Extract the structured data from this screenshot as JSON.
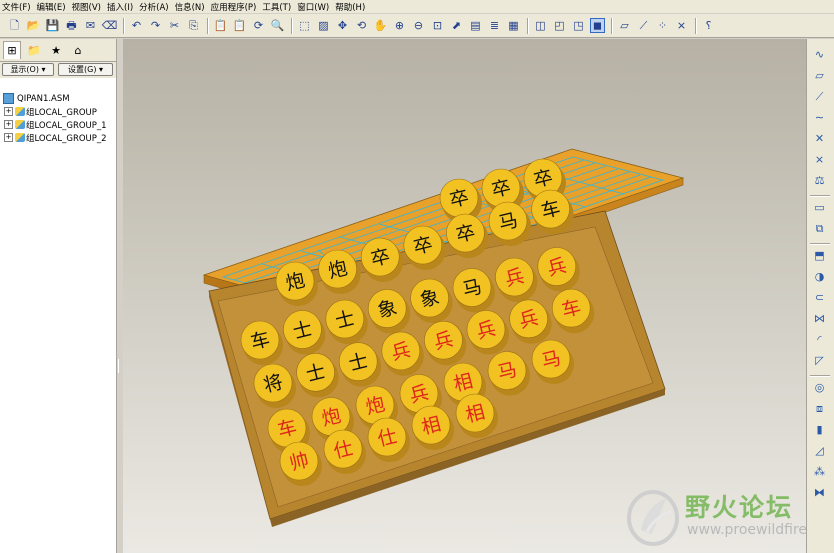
{
  "menu": [
    "文件(F)",
    "编辑(E)",
    "视图(V)",
    "插入(I)",
    "分析(A)",
    "信息(N)",
    "应用程序(P)",
    "工具(T)",
    "窗口(W)",
    "帮助(H)"
  ],
  "toolbar_icons": [
    {
      "name": "new-icon",
      "glyph": "🗋"
    },
    {
      "name": "open-icon",
      "glyph": "📂"
    },
    {
      "name": "save-icon",
      "glyph": "💾"
    },
    {
      "name": "print-icon",
      "glyph": "🖶"
    },
    {
      "name": "send-icon",
      "glyph": "✉"
    },
    {
      "name": "erase-icon",
      "glyph": "⌫"
    },
    {
      "name": "undo-icon",
      "glyph": "↶"
    },
    {
      "name": "redo-icon",
      "glyph": "↷"
    },
    {
      "name": "cut-icon",
      "glyph": "✂"
    },
    {
      "name": "copy-icon",
      "glyph": "⎘"
    },
    {
      "name": "paste-icon",
      "glyph": "📋"
    },
    {
      "name": "paste-special-icon",
      "glyph": "📋"
    },
    {
      "name": "regenerate-icon",
      "glyph": "⟳"
    },
    {
      "name": "find-icon",
      "glyph": "🔍"
    },
    {
      "name": "select-box-icon",
      "glyph": "⬚"
    },
    {
      "name": "repaint-icon",
      "glyph": "▨"
    },
    {
      "name": "spin-center-icon",
      "glyph": "✥"
    },
    {
      "name": "orient-icon",
      "glyph": "⟲"
    },
    {
      "name": "pan-icon",
      "glyph": "✋"
    },
    {
      "name": "zoom-in-icon",
      "glyph": "⊕"
    },
    {
      "name": "zoom-out-icon",
      "glyph": "⊖"
    },
    {
      "name": "refit-icon",
      "glyph": "⊡"
    },
    {
      "name": "view-orient-icon",
      "glyph": "⬈"
    },
    {
      "name": "saved-views-icon",
      "glyph": "▤"
    },
    {
      "name": "layers-icon",
      "glyph": "≣"
    },
    {
      "name": "view-manager-icon",
      "glyph": "▦"
    },
    {
      "name": "wireframe-icon",
      "glyph": "◫"
    },
    {
      "name": "hidden-line-icon",
      "glyph": "◰"
    },
    {
      "name": "no-hidden-icon",
      "glyph": "◳"
    },
    {
      "name": "shading-icon",
      "glyph": "◼"
    },
    {
      "name": "datum-plane-icon",
      "glyph": "▱"
    },
    {
      "name": "datum-axis-icon",
      "glyph": "⟋"
    },
    {
      "name": "datum-point-icon",
      "glyph": "⁘"
    },
    {
      "name": "coord-sys-icon",
      "glyph": "⨯"
    },
    {
      "name": "context-help-icon",
      "glyph": "⸮"
    }
  ],
  "panel": {
    "show_button": "显示(O) ▾",
    "settings_button": "设置(G) ▾",
    "tree": {
      "root": "QIPAN1.ASM",
      "groups": [
        "组LOCAL_GROUP",
        "组LOCAL_GROUP_1",
        "组LOCAL_GROUP_2"
      ]
    }
  },
  "right_toolbar_icons": [
    "sketch-icon",
    "plane-icon",
    "axis-icon",
    "curve-icon",
    "point-icon",
    "csys-icon",
    "analysis-icon",
    "note-icon",
    "copy-feature-icon",
    "extrude-icon",
    "revolve-icon",
    "sweep-icon",
    "blend-icon",
    "round-icon",
    "chamfer-icon",
    "hole-icon",
    "shell-icon",
    "rib-icon",
    "draft-icon",
    "pattern-icon",
    "mirror-icon"
  ],
  "board": {
    "top_row": [
      "卒",
      "卒",
      "卒",
      "卒",
      "卒"
    ],
    "rows": [
      [
        "车",
        "炮",
        "炮",
        "卒",
        "卒",
        "卒",
        "卒",
        "卒"
      ],
      [
        "车",
        "士",
        "士",
        "象",
        "象",
        "马",
        "马",
        "车"
      ],
      [
        "将",
        "士",
        "士",
        "象",
        "象",
        "马",
        "马",
        "车"
      ],
      [
        "车",
        "炮",
        "炮",
        "兵",
        "兵",
        "兵",
        "兵",
        "兵"
      ],
      [
        "帅",
        "仕",
        "仕",
        "相",
        "相",
        "马",
        "马",
        "车"
      ]
    ],
    "pieces": [
      {
        "t": "卒",
        "c": "black"
      },
      {
        "t": "卒",
        "c": "black"
      },
      {
        "t": "卒",
        "c": "black"
      },
      {
        "t": "炮",
        "c": "black"
      },
      {
        "t": "炮",
        "c": "black"
      },
      {
        "t": "卒",
        "c": "black"
      },
      {
        "t": "卒",
        "c": "black"
      },
      {
        "t": "卒",
        "c": "black"
      },
      {
        "t": "马",
        "c": "black"
      },
      {
        "t": "车",
        "c": "black"
      },
      {
        "t": "车",
        "c": "black"
      },
      {
        "t": "士",
        "c": "black"
      },
      {
        "t": "士",
        "c": "black"
      },
      {
        "t": "象",
        "c": "black"
      },
      {
        "t": "象",
        "c": "black"
      },
      {
        "t": "马",
        "c": "black"
      },
      {
        "t": "兵",
        "c": "red"
      },
      {
        "t": "兵",
        "c": "red"
      },
      {
        "t": "将",
        "c": "black"
      },
      {
        "t": "士",
        "c": "black"
      },
      {
        "t": "士",
        "c": "black"
      },
      {
        "t": "兵",
        "c": "red"
      },
      {
        "t": "兵",
        "c": "red"
      },
      {
        "t": "兵",
        "c": "red"
      },
      {
        "t": "兵",
        "c": "red"
      },
      {
        "t": "车",
        "c": "red"
      },
      {
        "t": "车",
        "c": "red"
      },
      {
        "t": "炮",
        "c": "red"
      },
      {
        "t": "炮",
        "c": "red"
      },
      {
        "t": "兵",
        "c": "red"
      },
      {
        "t": "相",
        "c": "red"
      },
      {
        "t": "马",
        "c": "red"
      },
      {
        "t": "马",
        "c": "red"
      },
      {
        "t": "帅",
        "c": "red"
      },
      {
        "t": "仕",
        "c": "red"
      },
      {
        "t": "仕",
        "c": "red"
      },
      {
        "t": "相",
        "c": "red"
      },
      {
        "t": "相",
        "c": "red"
      }
    ]
  },
  "watermark": {
    "title": "野火论坛",
    "url": "www.proewildfire.cn"
  },
  "colors": {
    "board_top": "#e8a12a",
    "board_body": "#b8852f",
    "piece": "#f2c222",
    "piece_edge": "#b8861a",
    "grid_line": "#35b6d8",
    "text_red": "#e0251a",
    "text_black": "#111111"
  }
}
